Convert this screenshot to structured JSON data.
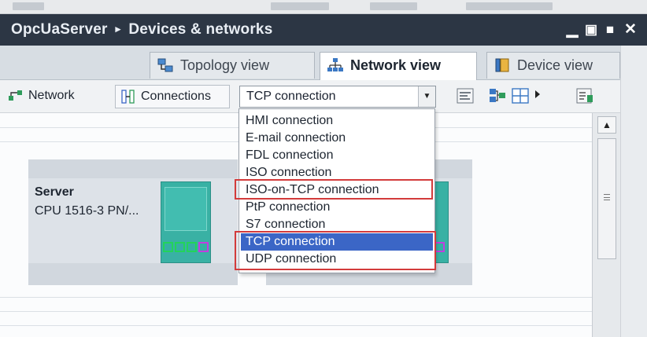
{
  "window": {
    "title_project": "OpcUaServer",
    "title_separator": "▸",
    "title_section": "Devices & networks",
    "controls": [
      "minimize-icon",
      "restore-icon",
      "maximize-icon",
      "close-icon"
    ],
    "control_glyphs": {
      "minimize": "▁",
      "restore": "▣",
      "maximize": "■",
      "close": "✕"
    }
  },
  "tabs": [
    {
      "label": "Topology view",
      "icon": "topology-icon",
      "active": false
    },
    {
      "label": "Network view",
      "icon": "network-view-icon",
      "active": true
    },
    {
      "label": "Device view",
      "icon": "device-view-icon",
      "active": false
    }
  ],
  "toolbar": {
    "network_label": "Network",
    "connections_label": "Connections",
    "connection_type_value": "TCP connection",
    "dropdown_arrow": "▼"
  },
  "dropdown": {
    "options": [
      "HMI connection",
      "E-mail connection",
      "FDL connection",
      "ISO connection",
      "ISO-on-TCP connection",
      "PtP connection",
      "S7 connection",
      "TCP connection",
      "UDP connection"
    ],
    "selected": "TCP connection",
    "highlighted_options": [
      "ISO-on-TCP connection",
      "TCP connection",
      "UDP connection"
    ]
  },
  "canvas": {
    "devices": [
      {
        "name": "Server",
        "type": "CPU 1516-3 PN/..."
      }
    ]
  },
  "colors": {
    "title_bar": "#2c3644",
    "selection": "#3b66c6",
    "highlight_border": "#d33b3b",
    "module": "#39b1a4"
  },
  "scrollbar": {
    "up_glyph": "▲"
  }
}
